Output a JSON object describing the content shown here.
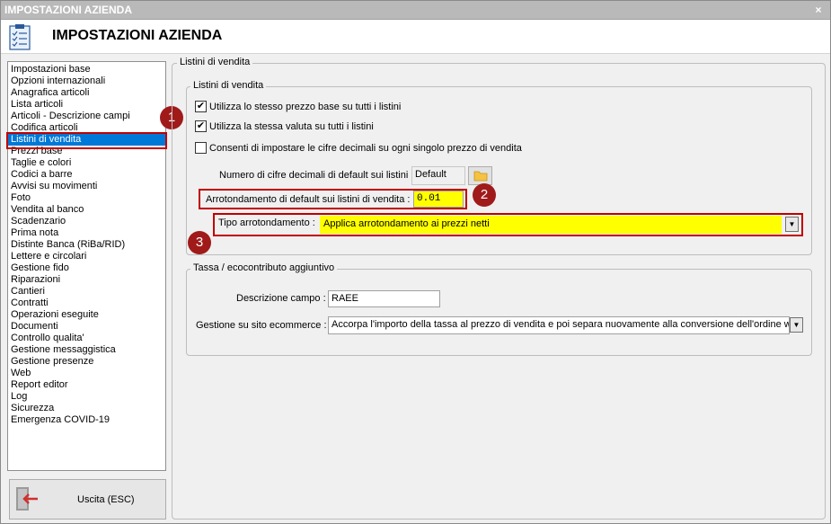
{
  "window": {
    "title": "IMPOSTAZIONI AZIENDA",
    "close_glyph": "×",
    "header_title": "IMPOSTAZIONI AZIENDA",
    "header_icon": "checklist-icon"
  },
  "sidebar": {
    "selected_index": 6,
    "items": [
      "Impostazioni base",
      "Opzioni internazionali",
      "Anagrafica articoli",
      "Lista articoli",
      "Articoli - Descrizione campi",
      "Codifica articoli",
      "Listini di vendita",
      "Prezzi base",
      "Taglie e colori",
      "Codici a barre",
      "Avvisi su movimenti",
      "Foto",
      "Vendita al banco",
      "Scadenzario",
      "Prima nota",
      "Distinte Banca (RiBa/RID)",
      "Lettere e circolari",
      "Gestione fido",
      "Riparazioni",
      "Cantieri",
      "Contratti",
      "Operazioni eseguite",
      "Documenti",
      "Controllo qualita'",
      "Gestione messaggistica",
      "Gestione presenze",
      "Web",
      "Report editor",
      "Log",
      "Sicurezza",
      "Emergenza COVID-19"
    ]
  },
  "exit_button": {
    "label": "Uscita (ESC)",
    "icon": "exit-door-icon"
  },
  "badges": {
    "b1": "1",
    "b2": "2",
    "b3": "3"
  },
  "main": {
    "outer_legend": "Listini di vendita",
    "price_group": {
      "legend": "Listini di vendita",
      "checkbox_same_price": {
        "label": "Utilizza lo stesso prezzo base su tutti i listini",
        "checked": true
      },
      "checkbox_same_currency": {
        "label": "Utilizza la stessa valuta su tutti i listini",
        "checked": true
      },
      "checkbox_decimals": {
        "label": "Consenti di impostare le cifre decimali su ogni singolo prezzo di vendita",
        "checked": false
      },
      "decimals_label": "Numero di cifre decimali di default sui listini :",
      "decimals_value": "Default",
      "rounding_label": "Arrotondamento di default sui listini di vendita :",
      "rounding_value": "0.01",
      "rounding_type_label": "Tipo arrotondamento :",
      "rounding_type_value": "Applica arrotondamento ai prezzi netti"
    },
    "tax_group": {
      "legend": "Tassa / ecocontributo aggiuntivo",
      "field_desc_label": "Descrizione campo :",
      "field_desc_value": "RAEE",
      "ecommerce_label": "Gestione su sito ecommerce :",
      "ecommerce_value": "Accorpa l'importo della tassa al prezzo di vendita e poi separa nuovamente alla conversione dell'ordine web"
    }
  },
  "colors": {
    "highlight_red": "#c00000",
    "badge_red": "#a01a1a",
    "selection_blue": "#0078d7",
    "field_yellow": "#ffff00"
  }
}
